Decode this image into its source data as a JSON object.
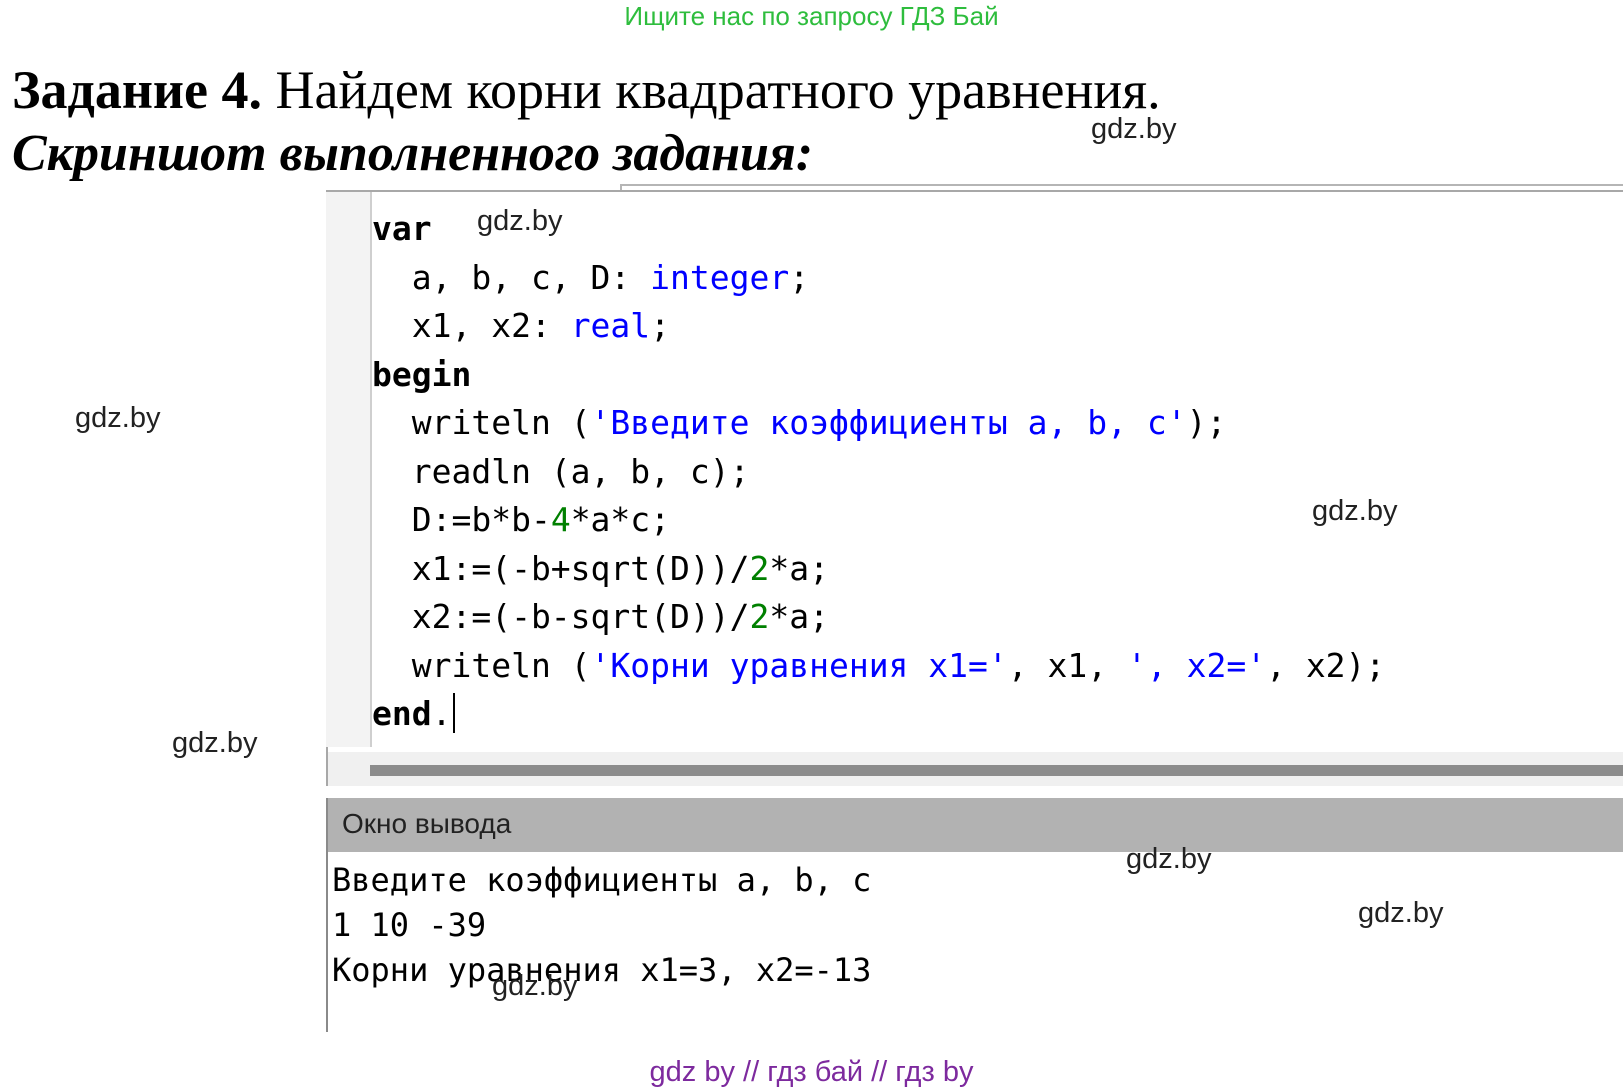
{
  "header": {
    "top_link": "Ищите нас по запросу ГДЗ Бай",
    "title_bold": "Задание 4.",
    "title_rest": " Найдем корни квадратного уравнения.",
    "subtitle": "Скриншот выполненного задания:"
  },
  "watermarks": [
    "gdz.by",
    "gdz.by",
    "gdz.by",
    "gdz.by",
    "gdz.by",
    "gdz.by",
    "gdz.by",
    "gdz.by"
  ],
  "editor": {
    "lines": [
      [
        {
          "t": "var",
          "c": "kw"
        }
      ],
      [
        {
          "t": "  a, b, c, D: ",
          "c": ""
        },
        {
          "t": "integer",
          "c": "ty"
        },
        {
          "t": ";",
          "c": ""
        }
      ],
      [
        {
          "t": "  x1, x2: ",
          "c": ""
        },
        {
          "t": "real",
          "c": "ty"
        },
        {
          "t": ";",
          "c": ""
        }
      ],
      [
        {
          "t": "begin",
          "c": "kw"
        }
      ],
      [
        {
          "t": "  writeln (",
          "c": ""
        },
        {
          "t": "'Введите коэффициенты a, b, c'",
          "c": "str"
        },
        {
          "t": ");",
          "c": ""
        }
      ],
      [
        {
          "t": "  readln (a, b, c);",
          "c": ""
        }
      ],
      [
        {
          "t": "  D:=b*b-",
          "c": ""
        },
        {
          "t": "4",
          "c": "num"
        },
        {
          "t": "*a*c;",
          "c": ""
        }
      ],
      [
        {
          "t": "  x1:=(-b+sqrt(D))/",
          "c": ""
        },
        {
          "t": "2",
          "c": "num"
        },
        {
          "t": "*a;",
          "c": ""
        }
      ],
      [
        {
          "t": "  x2:=(-b-sqrt(D))/",
          "c": ""
        },
        {
          "t": "2",
          "c": "num"
        },
        {
          "t": "*a;",
          "c": ""
        }
      ],
      [
        {
          "t": "  writeln (",
          "c": ""
        },
        {
          "t": "'Корни уравнения x1='",
          "c": "str"
        },
        {
          "t": ", x1, ",
          "c": ""
        },
        {
          "t": "', x2='",
          "c": "str"
        },
        {
          "t": ", x2);",
          "c": ""
        }
      ],
      [
        {
          "t": "end",
          "c": "kw"
        },
        {
          "t": ".",
          "c": ""
        }
      ]
    ]
  },
  "output": {
    "title": "Окно вывода",
    "lines": [
      "Введите коэффициенты a, b, c",
      "1 10 -39",
      "Корни уравнения x1=3, x2=-13"
    ]
  },
  "footer": "gdz by  //  гдз бай  //  гдз by"
}
